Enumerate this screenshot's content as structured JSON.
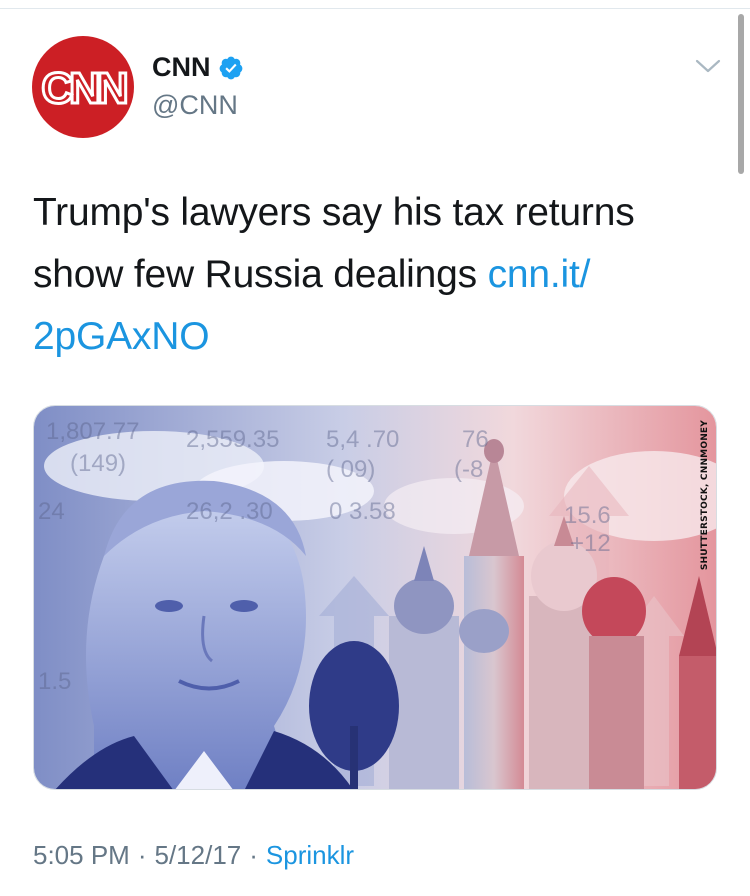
{
  "tweet": {
    "display_name": "CNN",
    "handle": "@CNN",
    "avatar_text": "CNN",
    "verified": true,
    "text_main": "Trump's lawyers say his tax returns show few Russia dealings ",
    "text_link": "cnn.it/ 2pGAxNO",
    "image_credit": "SHUTTERSTOCK, CNNMONEY",
    "tickers": [
      "1,807.77",
      "2,559.35",
      "5,4 .70",
      "76",
      "(149)",
      "(  09)",
      "(-8",
      "24",
      "26,2 .30",
      "0  3.58",
      "15.6",
      "+12",
      "1.5"
    ],
    "time": "5:05 PM",
    "date": "5/12/17",
    "source": "Sprinklr",
    "separator": "·"
  },
  "colors": {
    "link": "#1b95e0",
    "avatar_red": "#cc1f25",
    "muted": "#657786"
  }
}
